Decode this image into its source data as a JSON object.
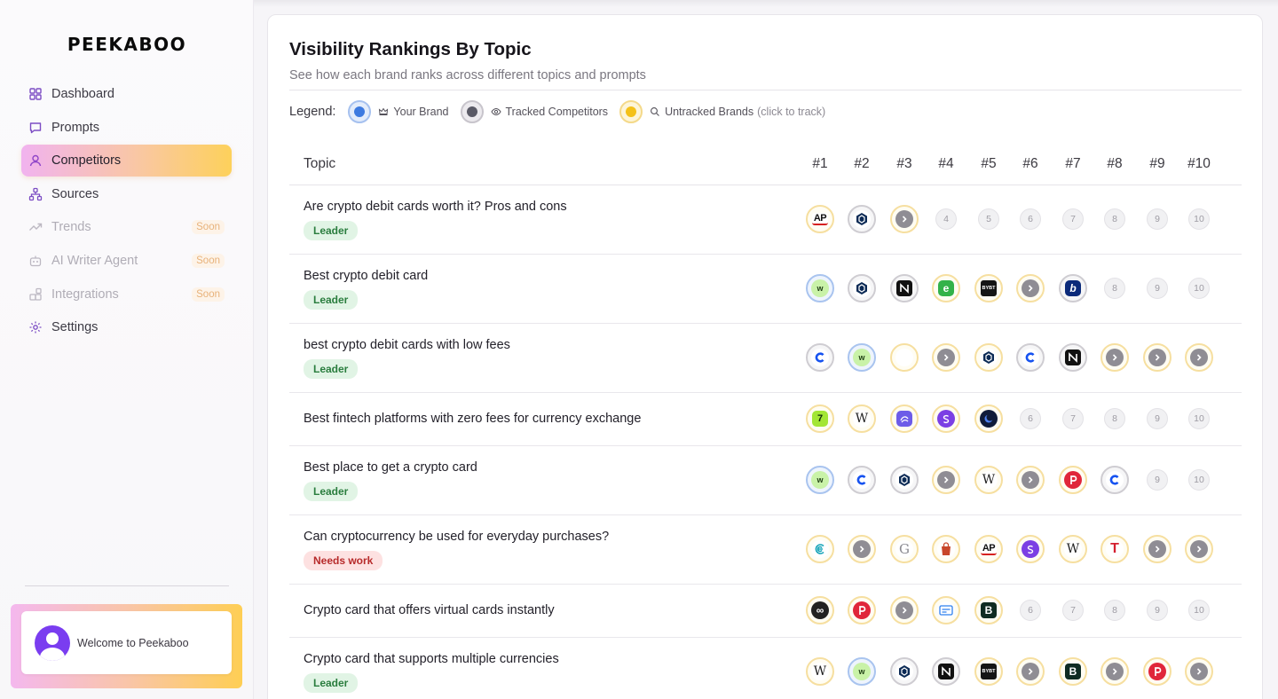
{
  "app": {
    "logo": "PEEKABOO"
  },
  "sidebar": {
    "items": [
      {
        "label": "Dashboard",
        "icon": "grid-icon",
        "state": "normal"
      },
      {
        "label": "Prompts",
        "icon": "message-icon",
        "state": "normal"
      },
      {
        "label": "Competitors",
        "icon": "user-icon",
        "state": "active"
      },
      {
        "label": "Sources",
        "icon": "sitemap-icon",
        "state": "normal"
      },
      {
        "label": "Trends",
        "icon": "trend-icon",
        "state": "disabled",
        "badge": "Soon"
      },
      {
        "label": "AI Writer Agent",
        "icon": "robot-icon",
        "state": "disabled",
        "badge": "Soon"
      },
      {
        "label": "Integrations",
        "icon": "blocks-icon",
        "state": "disabled",
        "badge": "Soon"
      },
      {
        "label": "Settings",
        "icon": "gear-icon",
        "state": "normal"
      }
    ],
    "welcome": "Welcome to Peekaboo"
  },
  "main": {
    "title": "Visibility Rankings By Topic",
    "subtitle": "See how each brand ranks across different topics and prompts",
    "legend": {
      "label": "Legend:",
      "your_brand": "Your Brand",
      "tracked": "Tracked Competitors",
      "untracked": "Untracked Brands",
      "untracked_hint": "(click to track)"
    },
    "table": {
      "topic_header": "Topic",
      "rank_headers": [
        "#1",
        "#2",
        "#3",
        "#4",
        "#5",
        "#6",
        "#7",
        "#8",
        "#9",
        "#10"
      ],
      "rows": [
        {
          "topic": "Are crypto debit cards worth it? Pros and cons",
          "badge": "Leader",
          "badge_type": "leader",
          "cells": [
            [
              "y",
              "ap"
            ],
            [
              "g",
              "cro"
            ],
            [
              "y",
              "arrow"
            ],
            [
              "e",
              "4"
            ],
            [
              "e",
              "5"
            ],
            [
              "e",
              "6"
            ],
            [
              "e",
              "7"
            ],
            [
              "e",
              "8"
            ],
            [
              "e",
              "9"
            ],
            [
              "e",
              "10"
            ]
          ]
        },
        {
          "topic": "Best crypto debit card",
          "badge": "Leader",
          "badge_type": "leader",
          "cells": [
            [
              "b",
              "w"
            ],
            [
              "g",
              "cro"
            ],
            [
              "g",
              "n"
            ],
            [
              "y",
              "e"
            ],
            [
              "y",
              "bybit"
            ],
            [
              "y",
              "arrow"
            ],
            [
              "g",
              "b2"
            ],
            [
              "e",
              "8"
            ],
            [
              "e",
              "9"
            ],
            [
              "e",
              "10"
            ]
          ]
        },
        {
          "topic": "best crypto debit cards with low fees",
          "badge": "Leader",
          "badge_type": "leader",
          "cells": [
            [
              "g",
              "c"
            ],
            [
              "b",
              "w"
            ],
            [
              "y",
              "blank"
            ],
            [
              "y",
              "arrow"
            ],
            [
              "y",
              "cro"
            ],
            [
              "g",
              "c"
            ],
            [
              "g",
              "n"
            ],
            [
              "y",
              "arrow"
            ],
            [
              "y",
              "arrow"
            ],
            [
              "y",
              "arrow"
            ]
          ]
        },
        {
          "topic": "Best fintech platforms with zero fees for currency exchange",
          "badge": "",
          "badge_type": "",
          "cells": [
            [
              "y",
              "rev"
            ],
            [
              "y",
              "wiki"
            ],
            [
              "y",
              "wave"
            ],
            [
              "y",
              "s"
            ],
            [
              "y",
              "moon"
            ],
            [
              "e",
              "6"
            ],
            [
              "e",
              "7"
            ],
            [
              "e",
              "8"
            ],
            [
              "e",
              "9"
            ],
            [
              "e",
              "10"
            ]
          ]
        },
        {
          "topic": "Best place to get a crypto card",
          "badge": "Leader",
          "badge_type": "leader",
          "cells": [
            [
              "b",
              "w"
            ],
            [
              "g",
              "c"
            ],
            [
              "g",
              "cro"
            ],
            [
              "y",
              "arrow"
            ],
            [
              "y",
              "wiki"
            ],
            [
              "y",
              "arrow"
            ],
            [
              "y",
              "p"
            ],
            [
              "g",
              "c"
            ],
            [
              "e",
              "9"
            ],
            [
              "e",
              "10"
            ]
          ]
        },
        {
          "topic": "Can cryptocurrency be used for everyday purchases?",
          "badge": "Needs work",
          "badge_type": "work",
          "cells": [
            [
              "y",
              "ce"
            ],
            [
              "y",
              "arrow"
            ],
            [
              "y",
              "g"
            ],
            [
              "y",
              "bag"
            ],
            [
              "y",
              "ap"
            ],
            [
              "y",
              "s"
            ],
            [
              "y",
              "wiki"
            ],
            [
              "y",
              "t"
            ],
            [
              "y",
              "arrow"
            ],
            [
              "y",
              "arrow"
            ]
          ]
        },
        {
          "topic": "Crypto card that offers virtual cards instantly",
          "badge": "",
          "badge_type": "",
          "cells": [
            [
              "y",
              "inf"
            ],
            [
              "y",
              "p"
            ],
            [
              "y",
              "arrow"
            ],
            [
              "y",
              "card"
            ],
            [
              "y",
              "bb"
            ],
            [
              "e",
              "6"
            ],
            [
              "e",
              "7"
            ],
            [
              "e",
              "8"
            ],
            [
              "e",
              "9"
            ],
            [
              "e",
              "10"
            ]
          ]
        },
        {
          "topic": "Crypto card that supports multiple currencies",
          "badge": "Leader",
          "badge_type": "leader",
          "cells": [
            [
              "y",
              "wiki"
            ],
            [
              "b",
              "w"
            ],
            [
              "g",
              "cro"
            ],
            [
              "g",
              "n"
            ],
            [
              "y",
              "bybit"
            ],
            [
              "y",
              "arrow"
            ],
            [
              "y",
              "bb"
            ],
            [
              "y",
              "arrow"
            ],
            [
              "y",
              "p"
            ],
            [
              "y",
              "arrow"
            ]
          ]
        }
      ]
    }
  }
}
